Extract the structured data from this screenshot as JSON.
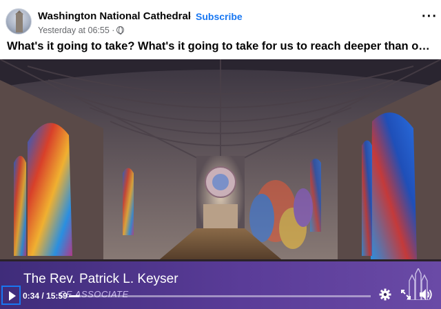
{
  "post": {
    "page_name": "Washington National Cathedral",
    "separator": "·",
    "subscribe_label": "Subscribe",
    "timestamp": "Yesterday at 06:55 ·",
    "caption": "What's it going to take? What's it going to take for us to reach deeper than o…",
    "avatar_icon": "cathedral-avatar",
    "privacy_icon": "globe-icon",
    "more_icon": "more-options-icon",
    "more_glyph": "···"
  },
  "video": {
    "scene_icon": "cathedral-nave-interior",
    "lower_third": {
      "speaker_name": "The Rev. Patrick L. Keyser",
      "speaker_title": "CE ASSOCIATE"
    },
    "controls": {
      "current_time": "0:34",
      "duration": "15:59",
      "time_separator": " / ",
      "progress_fraction": 0.035,
      "play_icon": "play-icon",
      "settings_icon": "gear-icon",
      "fullscreen_icon": "fullscreen-icon",
      "volume_icon": "volume-icon"
    }
  },
  "colors": {
    "brand_blue": "#1877f2",
    "banner_purple": "#5a3c98"
  }
}
